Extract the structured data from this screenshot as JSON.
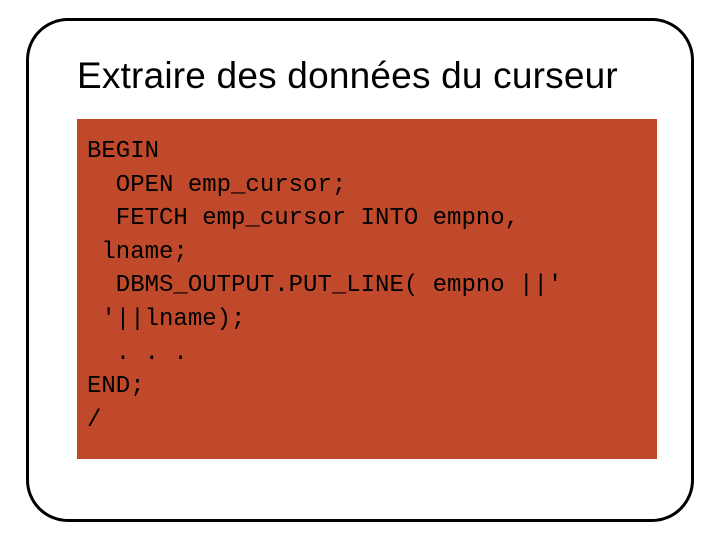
{
  "slide": {
    "title": "Extraire des données du curseur",
    "code": "BEGIN\n  OPEN emp_cursor;\n  FETCH emp_cursor INTO empno,\n lname;\n  DBMS_OUTPUT.PUT_LINE( empno ||'\n '||lname);\n  . . .\nEND;\n/"
  }
}
